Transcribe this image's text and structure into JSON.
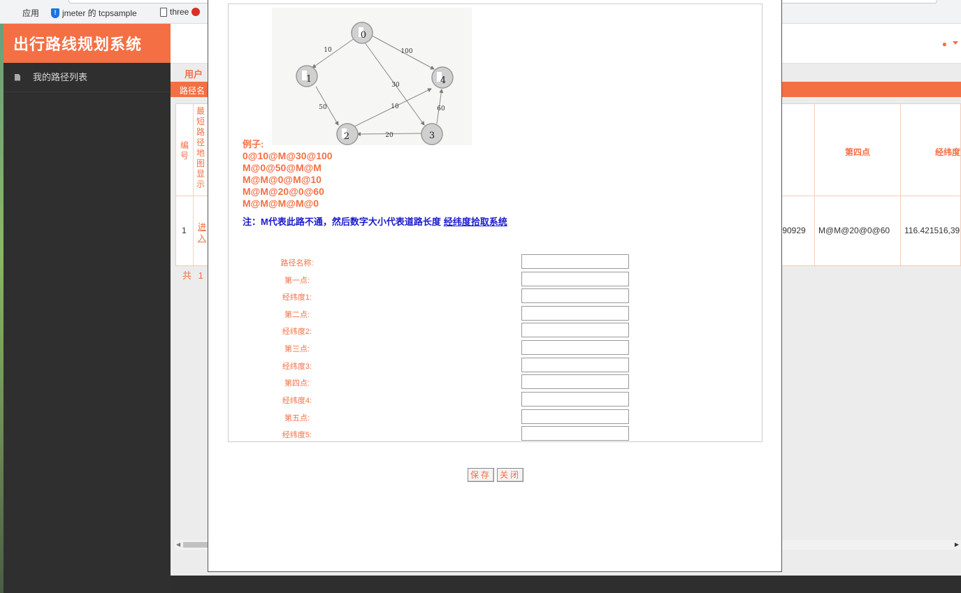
{
  "browser": {
    "bookmarks": [
      {
        "icon": "apps-grid-icon",
        "label": "应用"
      },
      {
        "icon": "shield-icon",
        "label": "jmeter 的 tcpsample"
      },
      {
        "icon": "page-icon",
        "label": "three"
      }
    ]
  },
  "app": {
    "title": "出行路线规划系统",
    "sidebar": [
      {
        "label": "我的路径列表"
      }
    ]
  },
  "main": {
    "breadcrumb": "用户",
    "band_label": "路径名",
    "table": {
      "headers": {
        "no": "编号",
        "map": "最短路径地图显示",
        "fourth": "第四点",
        "coord": "经纬度"
      },
      "row": {
        "no": "1",
        "link": "进入",
        "partial_coord": ".90929",
        "fourth": "M@M@20@0@60",
        "coord": "116.421516,39"
      }
    },
    "pager": "共 1 "
  },
  "modal": {
    "graph": {
      "nodes": [
        "0",
        "1",
        "2",
        "3",
        "4"
      ],
      "edge_labels": [
        "10",
        "100",
        "30",
        "50",
        "10",
        "60",
        "20"
      ]
    },
    "examples": {
      "title": "例子:",
      "lines": [
        "0@10@M@30@100",
        "M@0@50@M@M",
        "M@M@0@M@10",
        "M@M@20@0@60",
        "M@M@M@M@0"
      ]
    },
    "note": {
      "text": "注：M代表此路不通，然后数字大小代表道路长度",
      "link": "经纬度拾取系统"
    },
    "form": [
      {
        "label": "路径名称:",
        "value": ""
      },
      {
        "label": "第一点:",
        "value": ""
      },
      {
        "label": "经纬度1:",
        "value": ""
      },
      {
        "label": "第二点:",
        "value": ""
      },
      {
        "label": "经纬度2:",
        "value": ""
      },
      {
        "label": "第三点:",
        "value": ""
      },
      {
        "label": "经纬度3:",
        "value": ""
      },
      {
        "label": "第四点:",
        "value": ""
      },
      {
        "label": "经纬度4:",
        "value": ""
      },
      {
        "label": "第五点:",
        "value": ""
      },
      {
        "label": "经纬度5:",
        "value": ""
      }
    ],
    "buttons": {
      "save": "保存",
      "close": "关闭"
    }
  },
  "colors": {
    "accent": "#f46f44",
    "sidebar": "#2f2f2f",
    "note_blue": "#1a1acc"
  }
}
